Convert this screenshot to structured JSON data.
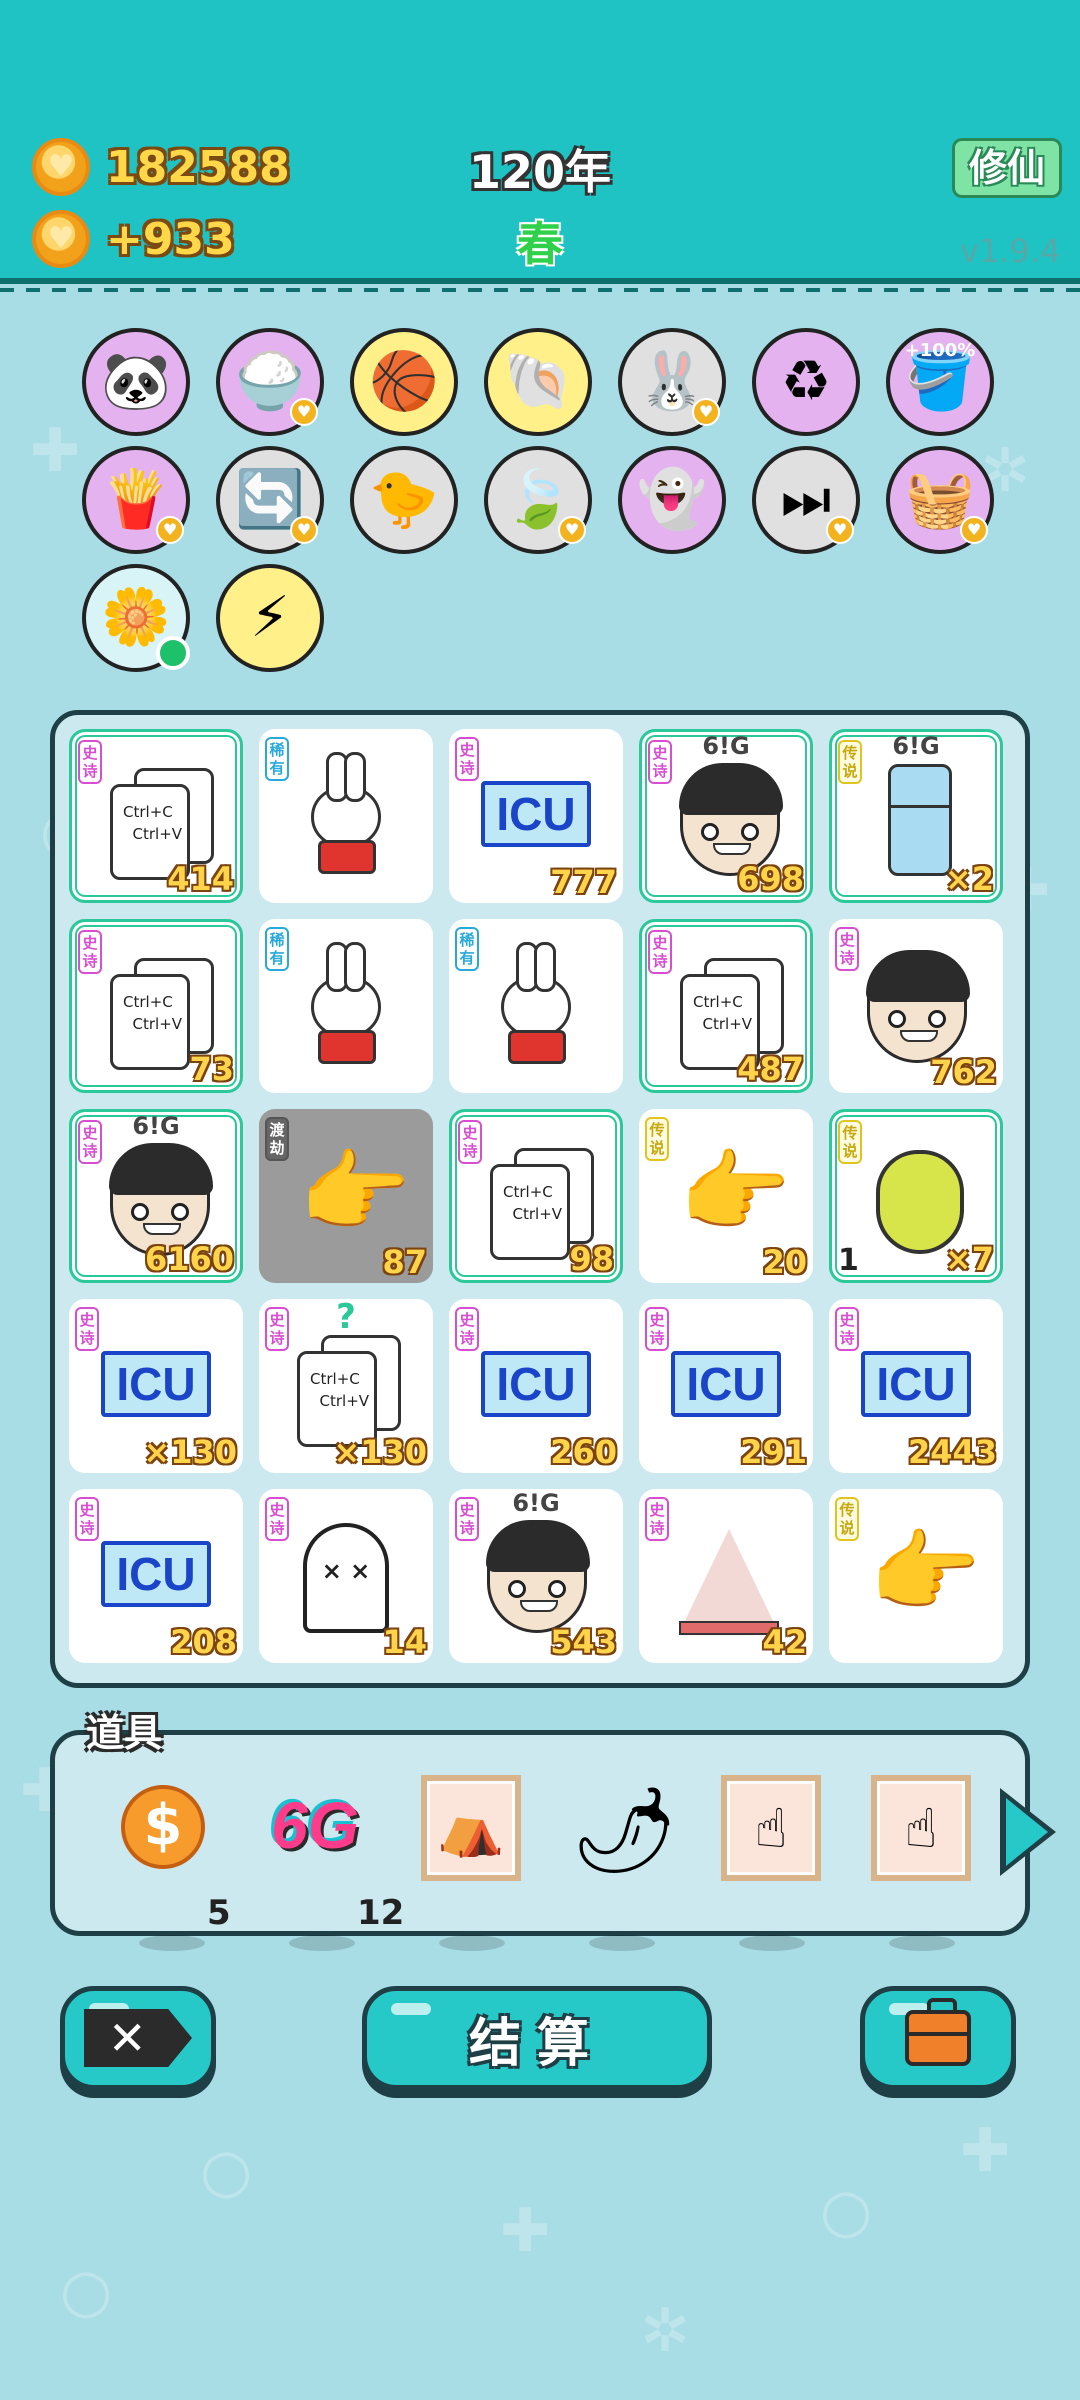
{
  "header": {
    "coins": "182588",
    "income": "+933",
    "year": "120年",
    "season": "春",
    "xiuxian_label": "修仙",
    "version": "v1.9.4",
    "coin_icon": "heart-coin-icon"
  },
  "relics": [
    {
      "icon": "panda-icon",
      "bg": "#e4b2ef"
    },
    {
      "icon": "rice-bowl-icon",
      "bg": "#e4b2ef",
      "heart": true
    },
    {
      "icon": "basketballs-icon",
      "bg": "#fff08a"
    },
    {
      "icon": "shell-icon",
      "bg": "#fff08a"
    },
    {
      "icon": "rabbit-icon",
      "bg": "#e0e0e0",
      "heart": true
    },
    {
      "icon": "recycle-icon",
      "bg": "#e4b2ef"
    },
    {
      "icon": "bucket-icon",
      "bg": "#e4b2ef",
      "pct": "+100%"
    },
    {
      "icon": "fries-icon",
      "bg": "#e4b2ef",
      "heart": true
    },
    {
      "icon": "refresh-icon",
      "bg": "#e0e0e0",
      "heart": true
    },
    {
      "icon": "chick-egg-icon",
      "bg": "#e0e0e0"
    },
    {
      "icon": "leaf-icon",
      "bg": "#e0e0e0",
      "heart": true
    },
    {
      "icon": "ghost-lantern-icon",
      "bg": "#e4b2ef"
    },
    {
      "icon": "skip-icon",
      "bg": "#e0e0e0",
      "heart": true
    },
    {
      "icon": "fruit-basket-icon",
      "bg": "#e4b2ef",
      "heart": true
    },
    {
      "icon": "flower-pot-icon",
      "bg": "#d8f4f7",
      "dot": true
    },
    {
      "icon": "lightning-icon",
      "bg": "#fff08a"
    }
  ],
  "board": {
    "cells": [
      {
        "kind": "copy",
        "tag": "史诗",
        "tier": "epic",
        "count": "414",
        "border": true
      },
      {
        "kind": "rabbit",
        "tag": "稀有",
        "tier": "rare",
        "count": ""
      },
      {
        "kind": "icu",
        "tag": "史诗",
        "tier": "epic",
        "count": "777"
      },
      {
        "kind": "face",
        "tag": "史诗",
        "tier": "epic",
        "count": "698",
        "badge": "6!G",
        "border": true
      },
      {
        "kind": "fridge",
        "tag": "传说",
        "tier": "legend",
        "count": "×2",
        "badge": "6!G",
        "border": true
      },
      {
        "kind": "copy",
        "tag": "史诗",
        "tier": "epic",
        "count": "73",
        "border": true
      },
      {
        "kind": "rabbit",
        "tag": "稀有",
        "tier": "rare",
        "count": ""
      },
      {
        "kind": "rabbit",
        "tag": "稀有",
        "tier": "rare",
        "count": ""
      },
      {
        "kind": "copy",
        "tag": "史诗",
        "tier": "epic",
        "count": "487",
        "border": true
      },
      {
        "kind": "face",
        "tag": "史诗",
        "tier": "epic",
        "count": "762"
      },
      {
        "kind": "face",
        "tag": "史诗",
        "tier": "epic",
        "count": "6160",
        "badge": "6!G",
        "border": true
      },
      {
        "kind": "hand",
        "tag": "渡劫",
        "tier": "tribulation",
        "count": "87",
        "grey": true
      },
      {
        "kind": "copy",
        "tag": "史诗",
        "tier": "epic",
        "count": "98",
        "border": true
      },
      {
        "kind": "hand",
        "tag": "传说",
        "tier": "legend",
        "count": "20"
      },
      {
        "kind": "pear",
        "tag": "传说",
        "tier": "legend",
        "count": "×7",
        "left": "1",
        "border": true
      },
      {
        "kind": "icu",
        "tag": "史诗",
        "tier": "epic",
        "count": "×130"
      },
      {
        "kind": "copy",
        "tag": "史诗",
        "tier": "epic",
        "count": "×130",
        "question": "?"
      },
      {
        "kind": "icu",
        "tag": "史诗",
        "tier": "epic",
        "count": "260"
      },
      {
        "kind": "icu",
        "tag": "史诗",
        "tier": "epic",
        "count": "291"
      },
      {
        "kind": "icu",
        "tag": "史诗",
        "tier": "epic",
        "count": "2443"
      },
      {
        "kind": "icu",
        "tag": "史诗",
        "tier": "epic",
        "count": "208"
      },
      {
        "kind": "ghost",
        "tag": "史诗",
        "tier": "epic",
        "count": "14"
      },
      {
        "kind": "face",
        "tag": "史诗",
        "tier": "epic",
        "count": "543",
        "badge": "6!G"
      },
      {
        "kind": "tent",
        "tag": "史诗",
        "tier": "epic",
        "count": "42"
      },
      {
        "kind": "hand",
        "tag": "传说",
        "tier": "legend",
        "count": ""
      }
    ],
    "icu_text": "ICU",
    "copy_line1": "Ctrl+C",
    "copy_line2": "Ctrl+V",
    "ghost_eyes": "× ×"
  },
  "tools": {
    "title": "道具",
    "items": [
      {
        "kind": "coin",
        "glyph": "$",
        "qty": "5",
        "icon": "dollar-coin-icon"
      },
      {
        "kind": "sixg",
        "glyph": "6G",
        "qty": "12",
        "icon": "6g-icon"
      },
      {
        "kind": "frame",
        "glyph": "⛺",
        "qty": "",
        "icon": "tent-frame-icon"
      },
      {
        "kind": "pepper",
        "glyph": "🌶",
        "qty": "",
        "icon": "pepper-icon"
      },
      {
        "kind": "frame",
        "glyph": "☝",
        "qty": "",
        "icon": "hand-frame-icon"
      },
      {
        "kind": "frame",
        "glyph": "☝",
        "qty": "",
        "icon": "hand-frame-icon"
      }
    ]
  },
  "buttons": {
    "close_glyph": "✕",
    "settle_label": "结算",
    "bag_icon": "briefcase-icon"
  }
}
